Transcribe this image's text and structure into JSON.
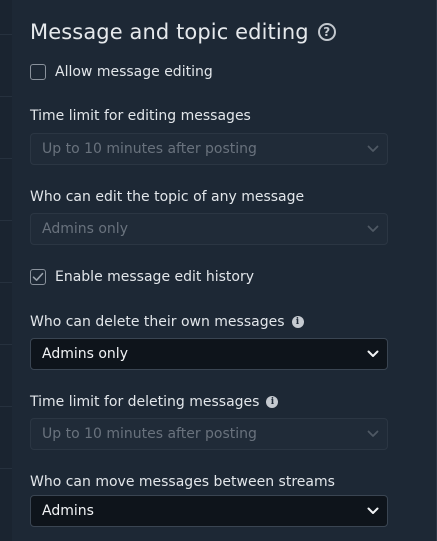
{
  "section": {
    "title": "Message and topic editing"
  },
  "allow_editing": {
    "label": "Allow message editing",
    "checked": false
  },
  "edit_time_limit": {
    "label": "Time limit for editing messages",
    "value": "Up to 10 minutes after posting",
    "disabled": true
  },
  "topic_edit": {
    "label": "Who can edit the topic of any message",
    "value": "Admins only",
    "disabled": true
  },
  "edit_history": {
    "label": "Enable message edit history",
    "checked": true
  },
  "delete_own": {
    "label": "Who can delete their own messages",
    "value": "Admins only",
    "disabled": false
  },
  "delete_time_limit": {
    "label": "Time limit for deleting messages",
    "value": "Up to 10 minutes after posting",
    "disabled": true
  },
  "move_streams": {
    "label": "Who can move messages between streams",
    "value": "Admins",
    "disabled": false
  },
  "icons": {
    "help": "question-circle-icon",
    "info": "info-circle-icon",
    "dropdown": "chevron-down-icon",
    "check": "check-icon"
  },
  "colors": {
    "background": "#1d2835",
    "text": "#e2e6ea",
    "disabled_text": "#69727d",
    "enabled_select_bg": "#0e141b"
  }
}
